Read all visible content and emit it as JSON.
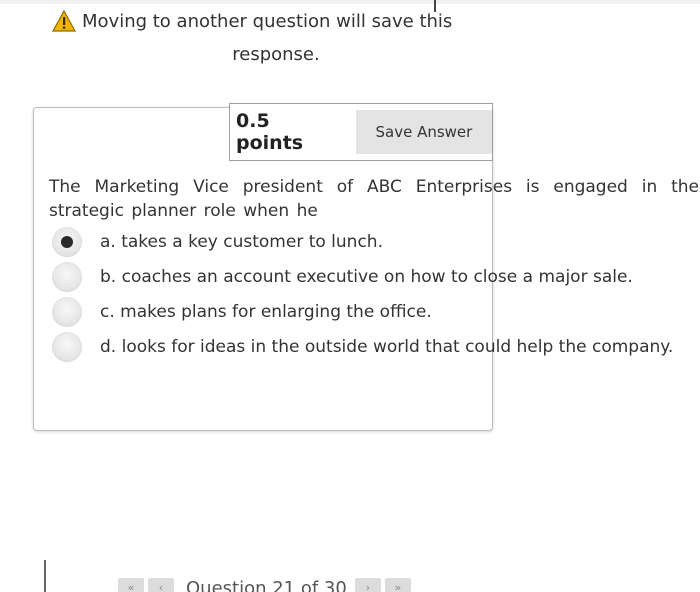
{
  "warning": {
    "icon": "warning-icon",
    "line1": "Moving to another question will save this",
    "line2": "response."
  },
  "question": {
    "points": "0.5 points",
    "save_label": "Save Answer",
    "text": "The Marketing Vice president of ABC Enterprises is engaged in the strategic planner role when he",
    "answers": [
      {
        "label": "a. takes a key customer to lunch.",
        "selected": true
      },
      {
        "label": "b. coaches an account executive on how to close a major sale.",
        "selected": false
      },
      {
        "label": "c. makes plans for enlarging the office.",
        "selected": false
      },
      {
        "label": "d. looks for ideas in the outside world that could help the company.",
        "selected": false
      }
    ]
  },
  "nav": {
    "first": "«",
    "prev": "‹",
    "label": "Question 21 of 30",
    "next": "›",
    "last": "»"
  },
  "colors": {
    "warning_yellow": "#f0b400",
    "button_bg": "#e4e4e4",
    "radio_dot": "#2b2b2b"
  }
}
